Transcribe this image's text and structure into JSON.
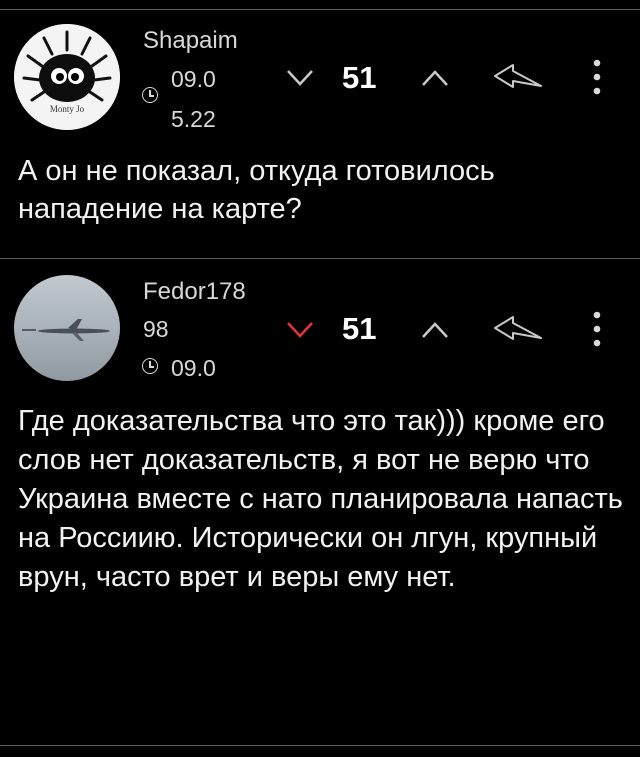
{
  "colors": {
    "background": "#000000",
    "text": "#f2f2f2",
    "meta": "#d8d8d8",
    "downvote_active": "#e8313c",
    "icon_inactive": "#c8c8c8",
    "separator": "#5a5a5a"
  },
  "comments": [
    {
      "username": "Shapaim",
      "avatar_icon": "monty-jo-avatar-icon",
      "avatar_caption": "Monty Jo",
      "meta_line_1": "09.0",
      "meta_line_2": "5.22",
      "score": "51",
      "downvoted": false,
      "text": "А он не показал, откуда готовилось нападение на карте?"
    },
    {
      "username": "Fedor178",
      "avatar_icon": "airplane-photo-avatar-icon",
      "meta_line_1": "98",
      "meta_line_2": "09.0",
      "score": "51",
      "downvoted": true,
      "text": "Где доказательства что это так))) кроме его слов нет доказательств, я вот не верю что Украина вместе с нато планировала напасть на Россиию. Исторически он лгун, крупный врун, часто врет и веры ему нет."
    }
  ]
}
